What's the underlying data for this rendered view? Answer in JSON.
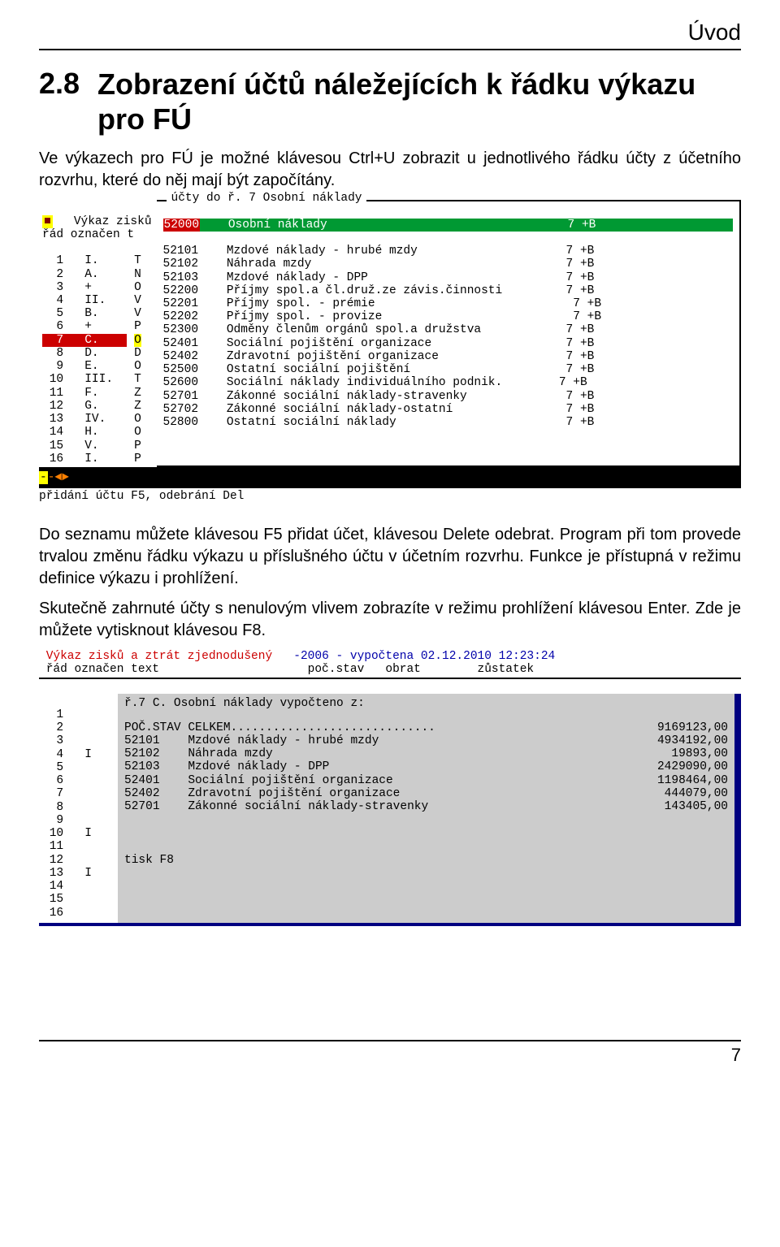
{
  "header": {
    "title": "Úvod"
  },
  "section": {
    "number": "2.8",
    "title": "Zobrazení účtů náležejících k řádku výkazu pro FÚ"
  },
  "intro": "Ve výkazech pro FÚ je možné klávesou Ctrl+U zobrazit u jednotlivého řádku účty z účetního rozvrhu, které do něj mají být započítány.",
  "scr1": {
    "corner": "■",
    "left_title": "Výkaz zisků",
    "left_header": "řád označen t",
    "rows": [
      {
        "r": "",
        "o": "",
        "t": ""
      },
      {
        "r": "1",
        "o": "I.",
        "t": "T"
      },
      {
        "r": "2",
        "o": "A.",
        "t": "N"
      },
      {
        "r": "3",
        "o": "+",
        "t": "O"
      },
      {
        "r": "4",
        "o": "II.",
        "t": "V"
      },
      {
        "r": "5",
        "o": "B.",
        "t": "V"
      },
      {
        "r": "6",
        "o": "+",
        "t": "P"
      },
      {
        "r": "7",
        "o": "C.",
        "t": "O"
      },
      {
        "r": "8",
        "o": "D.",
        "t": "D"
      },
      {
        "r": "9",
        "o": "E.",
        "t": "O"
      },
      {
        "r": "10",
        "o": "III.",
        "t": "T"
      },
      {
        "r": "11",
        "o": "F.",
        "t": "Z"
      },
      {
        "r": "12",
        "o": "G.",
        "t": "Z"
      },
      {
        "r": "13",
        "o": "IV.",
        "t": "O"
      },
      {
        "r": "14",
        "o": "H.",
        "t": "O"
      },
      {
        "r": "15",
        "o": "V.",
        "t": "P"
      },
      {
        "r": "16",
        "o": "I.",
        "t": "P"
      }
    ],
    "right_title": "účty do ř. 7 Osobní náklady",
    "accounts": [
      {
        "code": "52000",
        "name": "Osobní náklady",
        "r": "7",
        "f": "+B"
      },
      {
        "code": "52101",
        "name": "Mzdové náklady - hrubé mzdy",
        "r": "7",
        "f": "+B"
      },
      {
        "code": "52102",
        "name": "Náhrada mzdy",
        "r": "7",
        "f": "+B"
      },
      {
        "code": "52103",
        "name": "Mzdové náklady - DPP",
        "r": "7",
        "f": "+B"
      },
      {
        "code": "52200",
        "name": "Příjmy spol.a čl.druž.ze závis.činnosti",
        "r": "7",
        "f": "+B"
      },
      {
        "code": "52201",
        "name": "Příjmy spol. - prémie",
        "r": "7",
        "f": "+B"
      },
      {
        "code": "52202",
        "name": "Příjmy spol. - provize",
        "r": "7",
        "f": "+B"
      },
      {
        "code": "52300",
        "name": "Odměny členům orgánů spol.a družstva",
        "r": "7",
        "f": "+B"
      },
      {
        "code": "52401",
        "name": "Sociální pojištění organizace",
        "r": "7",
        "f": "+B"
      },
      {
        "code": "52402",
        "name": "Zdravotní pojištění organizace",
        "r": "7",
        "f": "+B"
      },
      {
        "code": "52500",
        "name": "Ostatní sociální pojištění",
        "r": "7",
        "f": "+B"
      },
      {
        "code": "52600",
        "name": "Sociální náklady individuálního podnik.",
        "r": "7",
        "f": "+B"
      },
      {
        "code": "52701",
        "name": "Zákonné sociální náklady-stravenky",
        "r": "7",
        "f": "+B"
      },
      {
        "code": "52702",
        "name": "Zákonné sociální náklady-ostatní",
        "r": "7",
        "f": "+B"
      },
      {
        "code": "52800",
        "name": "Ostatní sociální náklady",
        "r": "7",
        "f": "+B"
      }
    ],
    "status_arrow": "-◄►",
    "hint": "přidání účtu F5, odebrání Del"
  },
  "para2": "Do seznamu můžete klávesou F5 přidat účet, klávesou Delete odebrat. Program při tom provede trvalou změnu řádku výkazu u příslušného účtu v účetním rozvrhu. Funkce je přístupná v režimu definice výkazu i prohlížení.",
  "para3": "Skutečně zahrnuté účty s nenulovým vlivem zobrazíte v režimu prohlížení klávesou Enter. Zde je můžete vytisknout klávesou F8.",
  "scr2": {
    "title_left": "Výkaz zisků a ztrát zjednodušený",
    "title_mid": "-2006 - vypočtena",
    "title_right": "02.12.2010 12:23:24",
    "head": " řád označen text                     poč.stav   obrat        zůstatek",
    "rows": [
      {
        "r": "1",
        "o": ""
      },
      {
        "r": "2",
        "o": ""
      },
      {
        "r": "3",
        "o": ""
      },
      {
        "r": "4",
        "o": "I"
      },
      {
        "r": "5",
        "o": ""
      },
      {
        "r": "6",
        "o": ""
      },
      {
        "r": "7",
        "o": ""
      },
      {
        "r": "8",
        "o": ""
      },
      {
        "r": "9",
        "o": ""
      },
      {
        "r": "10",
        "o": "I"
      },
      {
        "r": "11",
        "o": ""
      },
      {
        "r": "12",
        "o": ""
      },
      {
        "r": "13",
        "o": "I"
      },
      {
        "r": "14",
        "o": ""
      },
      {
        "r": "15",
        "o": ""
      },
      {
        "r": "16",
        "o": ""
      }
    ],
    "panel_title": "ř.7 C. Osobní náklady vypočteno z:",
    "panel_rows": [
      {
        "l": "POČ.STAV CELKEM.............................",
        "v": "9169123,00"
      },
      {
        "l": "52101    Mzdové náklady - hrubé mzdy",
        "v": "4934192,00"
      },
      {
        "l": "52102    Náhrada mzdy",
        "v": "19893,00"
      },
      {
        "l": "52103    Mzdové náklady - DPP",
        "v": "2429090,00"
      },
      {
        "l": "52401    Sociální pojištění organizace",
        "v": "1198464,00"
      },
      {
        "l": "52402    Zdravotní pojištění organizace",
        "v": "444079,00"
      },
      {
        "l": "52701    Zákonné sociální náklady-stravenky",
        "v": "143405,00"
      }
    ],
    "panel_hint": "tisk F8"
  },
  "page_number": "7"
}
